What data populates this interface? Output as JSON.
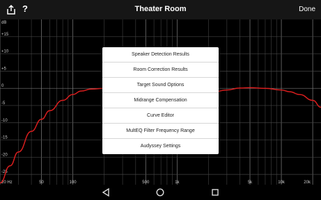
{
  "header": {
    "title": "Theater Room",
    "done_label": "Done",
    "help_label": "?"
  },
  "icons": {
    "share": "share-icon",
    "help": "help-icon",
    "back": "back-triangle-icon",
    "home": "home-circle-icon",
    "recents": "recents-square-icon"
  },
  "colors": {
    "curve": "#d91e1e",
    "grid": "#4a4a4a",
    "background": "#000000"
  },
  "chart_data": {
    "type": "line",
    "x_scale": "log",
    "xlim": [
      20,
      24000
    ],
    "ylim": [
      -28,
      20
    ],
    "ylabel": "dB",
    "x_ticks": [
      {
        "v": 20,
        "label": "20 Hz"
      },
      {
        "v": 50,
        "label": "50"
      },
      {
        "v": 100,
        "label": "100"
      },
      {
        "v": 500,
        "label": "500"
      },
      {
        "v": 1000,
        "label": "1k"
      },
      {
        "v": 5000,
        "label": "5k"
      },
      {
        "v": 10000,
        "label": "10k"
      },
      {
        "v": 20000,
        "label": "20k"
      }
    ],
    "y_ticks": [
      {
        "v": 15,
        "label": "+15"
      },
      {
        "v": 10,
        "label": "+10"
      },
      {
        "v": 5,
        "label": "+5"
      },
      {
        "v": 0,
        "label": "0"
      },
      {
        "v": -5,
        "label": "-5"
      },
      {
        "v": -10,
        "label": "-10"
      },
      {
        "v": -15,
        "label": "-15"
      },
      {
        "v": -20,
        "label": "-20"
      },
      {
        "v": -25,
        "label": "-25"
      }
    ],
    "series": [
      {
        "x": [
          20,
          25,
          30,
          40,
          50,
          60,
          80,
          100,
          120,
          150,
          200,
          1500,
          2000,
          3000,
          4000,
          5000,
          7000,
          10000,
          12000,
          15000,
          20000,
          24000
        ],
        "y": [
          -27.5,
          -22.5,
          -18.5,
          -12.5,
          -9,
          -6.5,
          -3.5,
          -1.8,
          -0.8,
          -0.2,
          0,
          -1.8,
          -1.5,
          -0.5,
          0.1,
          0.2,
          0,
          -0.5,
          -1.0,
          -1.8,
          -3.5,
          -5.5
        ]
      }
    ]
  },
  "menu": {
    "items": [
      {
        "label": "Speaker Detection Results"
      },
      {
        "label": "Room Correction Results"
      },
      {
        "label": "Target Sound Options"
      },
      {
        "label": "Midrange Compensation"
      },
      {
        "label": "Curve Editor"
      },
      {
        "label": "MultEQ Filter Frequency Range"
      },
      {
        "label": "Audyssey Settings"
      }
    ]
  }
}
